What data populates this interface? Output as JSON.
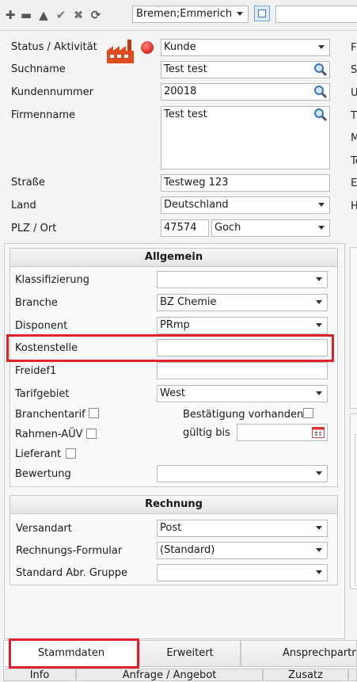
{
  "toolbar": {
    "icons": [
      "plus-icon",
      "minus-icon",
      "up-triangle-icon",
      "check-icon",
      "close-icon",
      "refresh-icon"
    ],
    "location_value": "Bremen;Emmerich",
    "search_value": ""
  },
  "customer": {
    "status_label": "Status / Aktivität",
    "status_value": "Kunde",
    "suchname_label": "Suchname",
    "suchname_value": "Test test",
    "kundennummer_label": "Kundennummer",
    "kundennummer_value": "20018",
    "firmenname_label": "Firmenname",
    "firmenname_value": "Test test",
    "strasse_label": "Straße",
    "strasse_value": "Testweg 123",
    "land_label": "Land",
    "land_value": "Deutschland",
    "plz_label": "PLZ / Ort",
    "plz_value": "47574",
    "ort_value": "Goch",
    "status_dot_color": "#e0302a"
  },
  "right_cutoff": [
    "F",
    "S",
    "U",
    "T",
    "M",
    "Te",
    "E",
    "H"
  ],
  "allgemein": {
    "title": "Allgemein",
    "klassifizierung_label": "Klassifizierung",
    "klassifizierung_value": "",
    "branche_label": "Branche",
    "branche_value": "BZ Chemie",
    "disponent_label": "Disponent",
    "disponent_value": "PRmp",
    "kostenstelle_label": "Kostenstelle",
    "kostenstelle_value": "",
    "freidef1_label": "Freidef1",
    "freidef1_value": "",
    "tarifgebiet_label": "Tarifgebiet",
    "tarifgebiet_value": "West",
    "branchentarif_label": "Branchentarif",
    "bestaetigung_label": "Bestätigung vorhanden",
    "rahmen_label": "Rahmen-AÜV",
    "gueltig_label": "gültig bis",
    "gueltig_value": "",
    "lieferant_label": "Lieferant",
    "bewertung_label": "Bewertung",
    "bewertung_value": ""
  },
  "rechnung": {
    "title": "Rechnung",
    "versandart_label": "Versandart",
    "versandart_value": "Post",
    "formular_label": "Rechnungs-Formular",
    "formular_value": "(Standard)",
    "abr_label": "Standard Abr. Gruppe",
    "abr_value": ""
  },
  "tabs": {
    "row1": [
      "Stammdaten",
      "Erweitert",
      "Ansprechpartne"
    ],
    "row2": [
      "Info",
      "Anfrage / Angebot",
      "Zusatz"
    ]
  },
  "colors": {
    "highlight": "#e0202a"
  }
}
